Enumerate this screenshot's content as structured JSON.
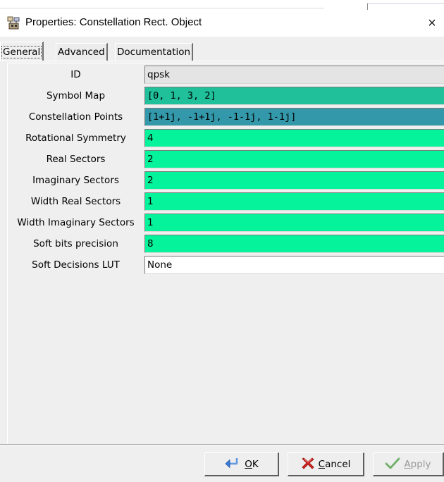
{
  "window": {
    "title": "Properties: Constellation Rect. Object",
    "close_glyph": "×",
    "icon": "blocks-app-icon"
  },
  "tabs": [
    {
      "label": "General",
      "active": true
    },
    {
      "label": "Advanced",
      "active": false
    },
    {
      "label": "Documentation",
      "active": false
    }
  ],
  "params": [
    {
      "label": "ID",
      "value": "qpsk",
      "bg": "#e4e4e4",
      "mono": false
    },
    {
      "label": "Symbol Map",
      "value": "[0, 1, 3, 2]",
      "bg": "#1fc09a",
      "mono": true
    },
    {
      "label": "Constellation Points",
      "value": "[1+1j, -1+1j, -1-1j, 1-1j]",
      "bg": "#3399aa",
      "mono": true
    },
    {
      "label": "Rotational Symmetry",
      "value": "4",
      "bg": "#05f39a",
      "mono": false
    },
    {
      "label": "Real Sectors",
      "value": "2",
      "bg": "#05f39a",
      "mono": false
    },
    {
      "label": "Imaginary Sectors",
      "value": "2",
      "bg": "#05f39a",
      "mono": false
    },
    {
      "label": "Width Real Sectors",
      "value": "1",
      "bg": "#05f39a",
      "mono": false
    },
    {
      "label": "Width Imaginary Sectors",
      "value": "1",
      "bg": "#05f39a",
      "mono": false
    },
    {
      "label": "Soft bits precision",
      "value": "8",
      "bg": "#05f39a",
      "mono": false
    },
    {
      "label": "Soft Decisions LUT",
      "value": "None",
      "bg": "#ffffff",
      "mono": false
    }
  ],
  "buttons": {
    "ok": {
      "label_u": "O",
      "label_rest": "K",
      "icon": "enter-arrow-icon",
      "enabled": true
    },
    "cancel": {
      "label_u": "C",
      "label_rest": "ancel",
      "icon": "red-x-icon",
      "enabled": true
    },
    "apply": {
      "label_u": "A",
      "label_rest": "pply",
      "icon": "checkmark-icon",
      "enabled": false
    }
  }
}
